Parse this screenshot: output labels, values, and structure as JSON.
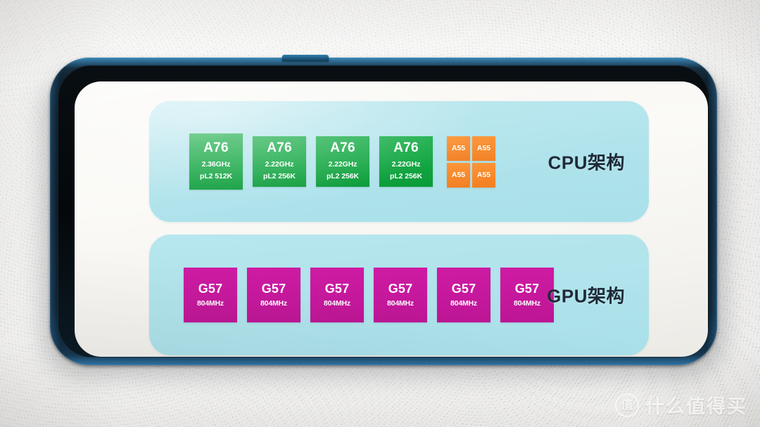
{
  "scene": {
    "subject": "smartphone displaying a chipset architecture slide",
    "background": "white knitted fabric"
  },
  "phone": {
    "frame_color": "#0a1319",
    "frame_accent_color": "#2f7fab",
    "screen_bg_color": "#f7f6f2",
    "side_button_label": "power-button"
  },
  "slide": {
    "panel_color": "#b2e4ec",
    "cpu": {
      "label": "CPU架构",
      "big_cores": [
        {
          "name": "A76",
          "clock": "2.36GHz",
          "cache": "pL2 512K",
          "lead": true
        },
        {
          "name": "A76",
          "clock": "2.22GHz",
          "cache": "pL2 256K",
          "lead": false
        },
        {
          "name": "A76",
          "clock": "2.22GHz",
          "cache": "pL2 256K",
          "lead": false
        },
        {
          "name": "A76",
          "clock": "2.22GHz",
          "cache": "pL2 256K",
          "lead": false
        }
      ],
      "big_core_color": "#0ba33c",
      "little_cores": [
        {
          "name": "A55"
        },
        {
          "name": "A55"
        },
        {
          "name": "A55"
        },
        {
          "name": "A55"
        }
      ],
      "little_core_color": "#f7882a"
    },
    "gpu": {
      "label": "GPU架构",
      "cores": [
        {
          "name": "G57",
          "clock": "804MHz"
        },
        {
          "name": "G57",
          "clock": "804MHz"
        },
        {
          "name": "G57",
          "clock": "804MHz"
        },
        {
          "name": "G57",
          "clock": "804MHz"
        },
        {
          "name": "G57",
          "clock": "804MHz"
        },
        {
          "name": "G57",
          "clock": "804MHz"
        }
      ],
      "core_color": "#c5189c"
    }
  },
  "watermark": {
    "logo_glyph": "值",
    "text": "什么值得买"
  }
}
